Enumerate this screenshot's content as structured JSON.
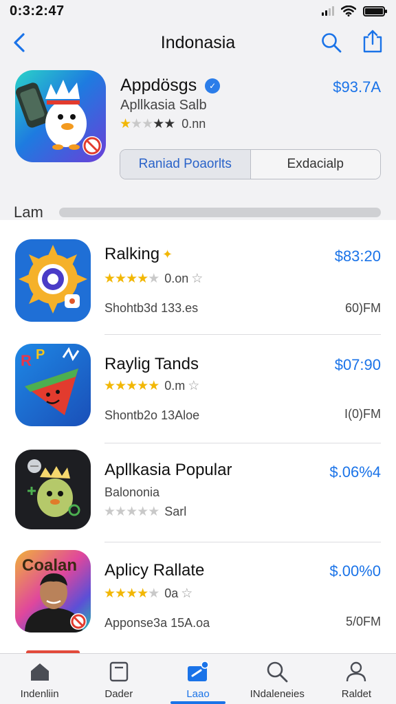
{
  "status": {
    "time": "0:3:2:47"
  },
  "nav": {
    "title": "Indonasia"
  },
  "featured": {
    "name": "Appdösgs",
    "subtitle": "Apllkasia Salb",
    "rating_text": "0.nn",
    "rating": 1,
    "price": "$93.7A",
    "icon": "duck-chef-icon"
  },
  "segments": {
    "active": "Raniad Poaorlts",
    "inactive": "Exdacialp"
  },
  "section": {
    "label": "Lam"
  },
  "apps": [
    {
      "name": "Ralking",
      "rating": 3.5,
      "rating_text": "0.on",
      "price": "$83:20",
      "meta": "Shohtb3d  133.es",
      "time": "60)FM",
      "icon": "sun-camera-icon"
    },
    {
      "name": "Raylig Tands",
      "rating": 4.5,
      "rating_text": "0.m",
      "price": "$07:90",
      "meta": "Shontb2o  13Aloe",
      "time": "I(0)FM",
      "icon": "watermelon-icon"
    },
    {
      "name": "Apllkasia Popular",
      "subtitle": "Balononia",
      "rating": 0,
      "rating_text": "Sarl",
      "price": "$.06%4",
      "icon": "crowned-bird-icon"
    },
    {
      "name": "Aplicy Rallate",
      "rating": 3.5,
      "rating_text": "0a",
      "price": "$.00%0",
      "meta": "Apponse3a  15A.oa",
      "time": "5/0FM",
      "icon": "portrait-icon"
    }
  ],
  "tabs": [
    {
      "label": "Indenliin",
      "icon": "home-icon"
    },
    {
      "label": "Dader",
      "icon": "square-icon"
    },
    {
      "label": "Laao",
      "icon": "folder-icon",
      "active": true
    },
    {
      "label": "INdaleneies",
      "icon": "search-icon"
    },
    {
      "label": "Raldet",
      "icon": "person-icon"
    }
  ],
  "colors": {
    "accent": "#1a73e8",
    "star": "#f2b705",
    "background": "#f2f2f4"
  }
}
